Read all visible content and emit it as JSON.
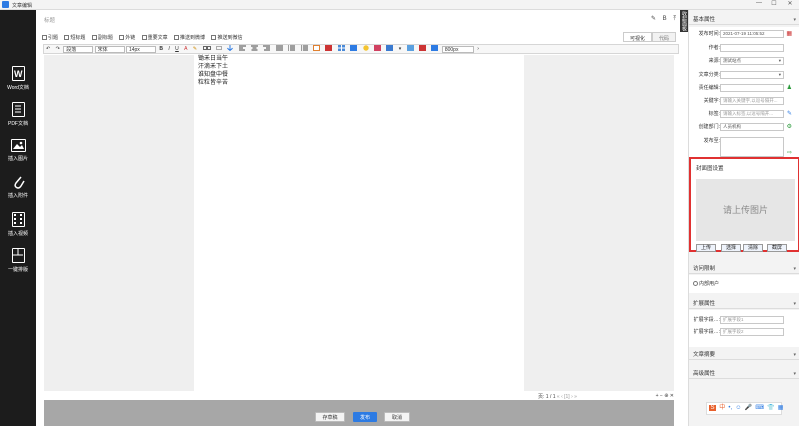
{
  "window": {
    "title": "文章编辑",
    "min": "—",
    "max": "☐",
    "close": "✕"
  },
  "sidebar": {
    "items": [
      {
        "label": "Word文档",
        "icon": "word-doc-icon"
      },
      {
        "label": "PDF文档",
        "icon": "pdf-doc-icon"
      },
      {
        "label": "插入图片",
        "icon": "image-icon"
      },
      {
        "label": "插入附件",
        "icon": "paperclip-icon"
      },
      {
        "label": "插入视频",
        "icon": "video-icon"
      },
      {
        "label": "一键排版",
        "icon": "layout-icon"
      }
    ]
  },
  "editor": {
    "title_placeholder": "标题",
    "top_icons": {
      "pen": "✎",
      "bold": "B",
      "pin": "⤒"
    },
    "checkboxes": [
      "引题",
      "短标题",
      "副标题",
      "外链",
      "重要文章",
      "推送到微博",
      "推送到微信"
    ],
    "mode_tabs": [
      "可视化",
      "代码"
    ],
    "toolbar": {
      "undo": "↶",
      "redo": "↷",
      "paragraph": "段落",
      "font": "宋体",
      "size": "14px",
      "bold": "B",
      "italic": "I",
      "underline": "U",
      "font_color": "A",
      "highlight": "✎",
      "zoom": "800px",
      "more": "›"
    },
    "content_lines": [
      "锄禾日当午",
      "汗滴禾下土",
      "谁知盘中餐",
      "粒粒皆辛苦"
    ],
    "status": {
      "page": "页: 1 / 1",
      "page_nav": "« ‹ [1] › »",
      "zoom": "+ − ⊕ ✕"
    },
    "buttons": {
      "draft": "存草稿",
      "publish": "发布",
      "cancel": "取消"
    }
  },
  "vtab": {
    "label": "收起面板"
  },
  "panel": {
    "basic": {
      "title": "基本属性",
      "publish_time_label": "发布时间:",
      "publish_time": "2021-07-19 11:05:52",
      "author_label": "作者:",
      "author": "",
      "source_label": "来源:",
      "source": "测试站点",
      "category_label": "文章分类:",
      "category": "",
      "editor_label": "责任编辑:",
      "editor": "",
      "keywords_label": "关键字:",
      "keywords_placeholder": "请输入关键字,以逗号隔开...",
      "tags_label": "标签:",
      "tags_placeholder": "请输入标签,以逗号隔开...",
      "dept_label": "创建部门:",
      "dept": "人员机构",
      "location_label": "发布至:",
      "location": ""
    },
    "cover": {
      "title": "封面图设置",
      "placeholder": "请上传图片",
      "upload": "上传",
      "choose": "选择",
      "clear": "清除",
      "crop": "截屏"
    },
    "access": {
      "title": "访问限制",
      "internal_label": "内部用户"
    },
    "extend": {
      "title": "扩展属性",
      "rows": [
        {
          "label": "扩展字段…:",
          "placeholder": "扩展字段1"
        },
        {
          "label": "扩展字段…:",
          "placeholder": "扩展字段2"
        }
      ]
    },
    "summary": {
      "title": "文章摘要"
    },
    "advanced": {
      "title": "高级属性"
    }
  },
  "floatbar": {
    "items": [
      "S",
      "中",
      "•,",
      "☺",
      "🎤",
      "⌨",
      "👕",
      "▦"
    ]
  },
  "colors": {
    "sidebar": "#1c1c1c",
    "accent": "#2d7be3",
    "highlight_border": "#e03131"
  }
}
